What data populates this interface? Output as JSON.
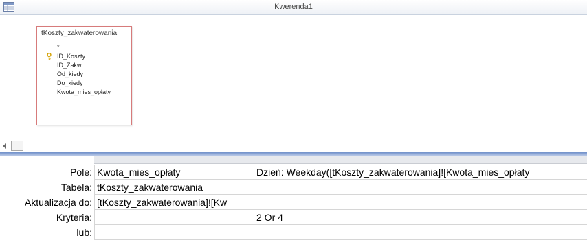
{
  "window": {
    "title": "Kwerenda1"
  },
  "table_box": {
    "name": "tKoszty_zakwaterowania",
    "fields": [
      "*",
      "ID_Koszty",
      "ID_Zakw",
      "Od_kiedy",
      "Do_kiedy",
      "Kwota_mies_opłaty"
    ],
    "primary_key_field": "ID_Koszty"
  },
  "grid": {
    "row_labels": {
      "pole": "Pole:",
      "tabela": "Tabela:",
      "aktualizacja": "Aktualizacja do:",
      "kryteria": "Kryteria:",
      "lub": "lub:"
    },
    "columns": [
      {
        "pole": "Kwota_mies_opłaty",
        "tabela": "tKoszty_zakwaterowania",
        "aktualizacja": "[tKoszty_zakwaterowania]![Kw",
        "kryteria": "",
        "lub": ""
      },
      {
        "pole": "Dzień: Weekday([tKoszty_zakwaterowania]![Kwota_mies_opłaty",
        "tabela": "",
        "aktualizacja": "",
        "kryteria": "2 Or 4",
        "lub": ""
      }
    ]
  },
  "icons": {
    "app": "query-design-icon",
    "key": "primary-key-icon",
    "scroll_left": "scroll-left-arrow-icon"
  },
  "colors": {
    "table_border": "#d77b7b",
    "splitter": "#6f8fc9",
    "key": "#d4a100"
  }
}
